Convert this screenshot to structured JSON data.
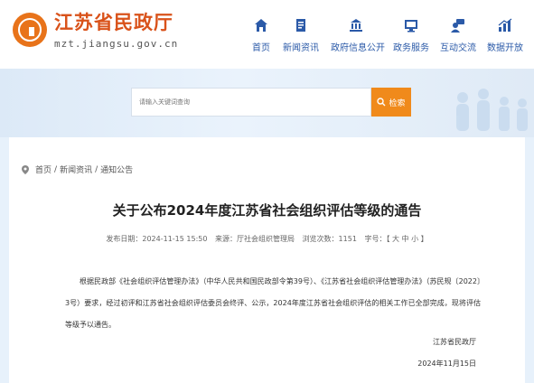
{
  "header": {
    "site_title": "江苏省民政厅",
    "site_url": "mzt.jiangsu.gov.cn",
    "nav": [
      {
        "label": "首页",
        "icon": "home-icon"
      },
      {
        "label": "新闻资讯",
        "icon": "news-icon"
      },
      {
        "label": "政府信息公开",
        "icon": "building-icon"
      },
      {
        "label": "政务服务",
        "icon": "monitor-icon"
      },
      {
        "label": "互动交流",
        "icon": "chat-user-icon"
      },
      {
        "label": "数据开放",
        "icon": "bar-chart-icon"
      }
    ]
  },
  "search": {
    "placeholder": "请输入关键词查询",
    "button_label": "检索"
  },
  "breadcrumb": {
    "home": "首页",
    "sep1": "/",
    "section": "新闻资讯",
    "sep2": "/",
    "current": "通知公告"
  },
  "article": {
    "title": "关于公布2024年度江苏省社会组织评估等级的通告",
    "publish_time": "发布日期：2024-11-15 15:50",
    "source": "来源：厅社会组织管理局",
    "views": "浏览次数：1151",
    "font_size": "字号：【 大 中 小 】",
    "body": "根据民政部《社会组织评估管理办法》（中华人民共和国民政部令第39号）、《江苏省社会组织评估管理办法》（苏民规〔2022〕3号）要求，经过初评和江苏省社会组织评估委员会终评、公示，2024年度江苏省社会组织评估的相关工作已全部完成，现将评估等级予以通告。",
    "signature_org": "江苏省民政厅",
    "signature_date": "2024年11月15日"
  },
  "colors": {
    "brand_orange": "#e8731a",
    "nav_blue": "#2b5aa8",
    "search_button": "#f08a1b"
  }
}
